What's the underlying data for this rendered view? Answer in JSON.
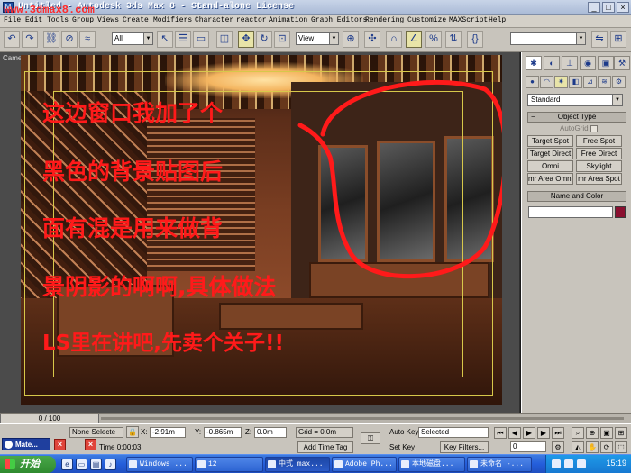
{
  "window": {
    "title": "Untitled - Autodesk 3ds Max 8 - Stand-alone License",
    "watermark": "www.3dmax8.com",
    "controls": [
      "_",
      "□",
      "×"
    ]
  },
  "menu": [
    "File",
    "Edit",
    "Tools",
    "Group",
    "Views",
    "Create",
    "Modifiers",
    "Character",
    "reactor",
    "Animation",
    "Graph Editors",
    "Rendering",
    "Customize",
    "MAXScript",
    "Help"
  ],
  "toolbar": {
    "selection_filter": "All",
    "ref_coord": "View",
    "named_selection": ""
  },
  "viewport": {
    "label": "Camera01",
    "annotation_lines": [
      "这边窗口我加了个",
      "黑色的背景贴图后",
      "面有混是用来做背",
      "景阴影的啊啊,具体做法",
      "LS里在讲吧,先卖个关子!!"
    ],
    "annotation_color": "#ff1a1a"
  },
  "command_panel": {
    "category": "Standard",
    "object_type_title": "Object Type",
    "autogrid": "AutoGrid",
    "buttons": [
      "Target Spot",
      "Free Spot",
      "Target Direct",
      "Free Direct",
      "Omni",
      "Skylight",
      "mr Area Omni",
      "mr Area Spot"
    ],
    "name_color_title": "Name and Color",
    "swatch_color": "#8a1030"
  },
  "timeline": {
    "frame": "0 / 100"
  },
  "status": {
    "selection": "None Selecte",
    "x": "-2.91m",
    "y": "-0.865m",
    "z": "0.0m",
    "grid": "Grid = 0.0m",
    "time": "Time 0:00:03",
    "add_time_tag": "Add Time Tag",
    "auto_key": "Auto Key",
    "set_key": "Set Key",
    "key_mode": "Selected",
    "key_filters": "Key Filters...",
    "current_frame": "0",
    "mini_task": "Mate..."
  },
  "taskbar": {
    "start": "开始",
    "tasks": [
      "Windows ...",
      "12",
      "中式 max...",
      "Adobe Ph...",
      "本地磁盘...",
      "未命名 -..."
    ],
    "active_task": 2,
    "clock": "15:19"
  }
}
